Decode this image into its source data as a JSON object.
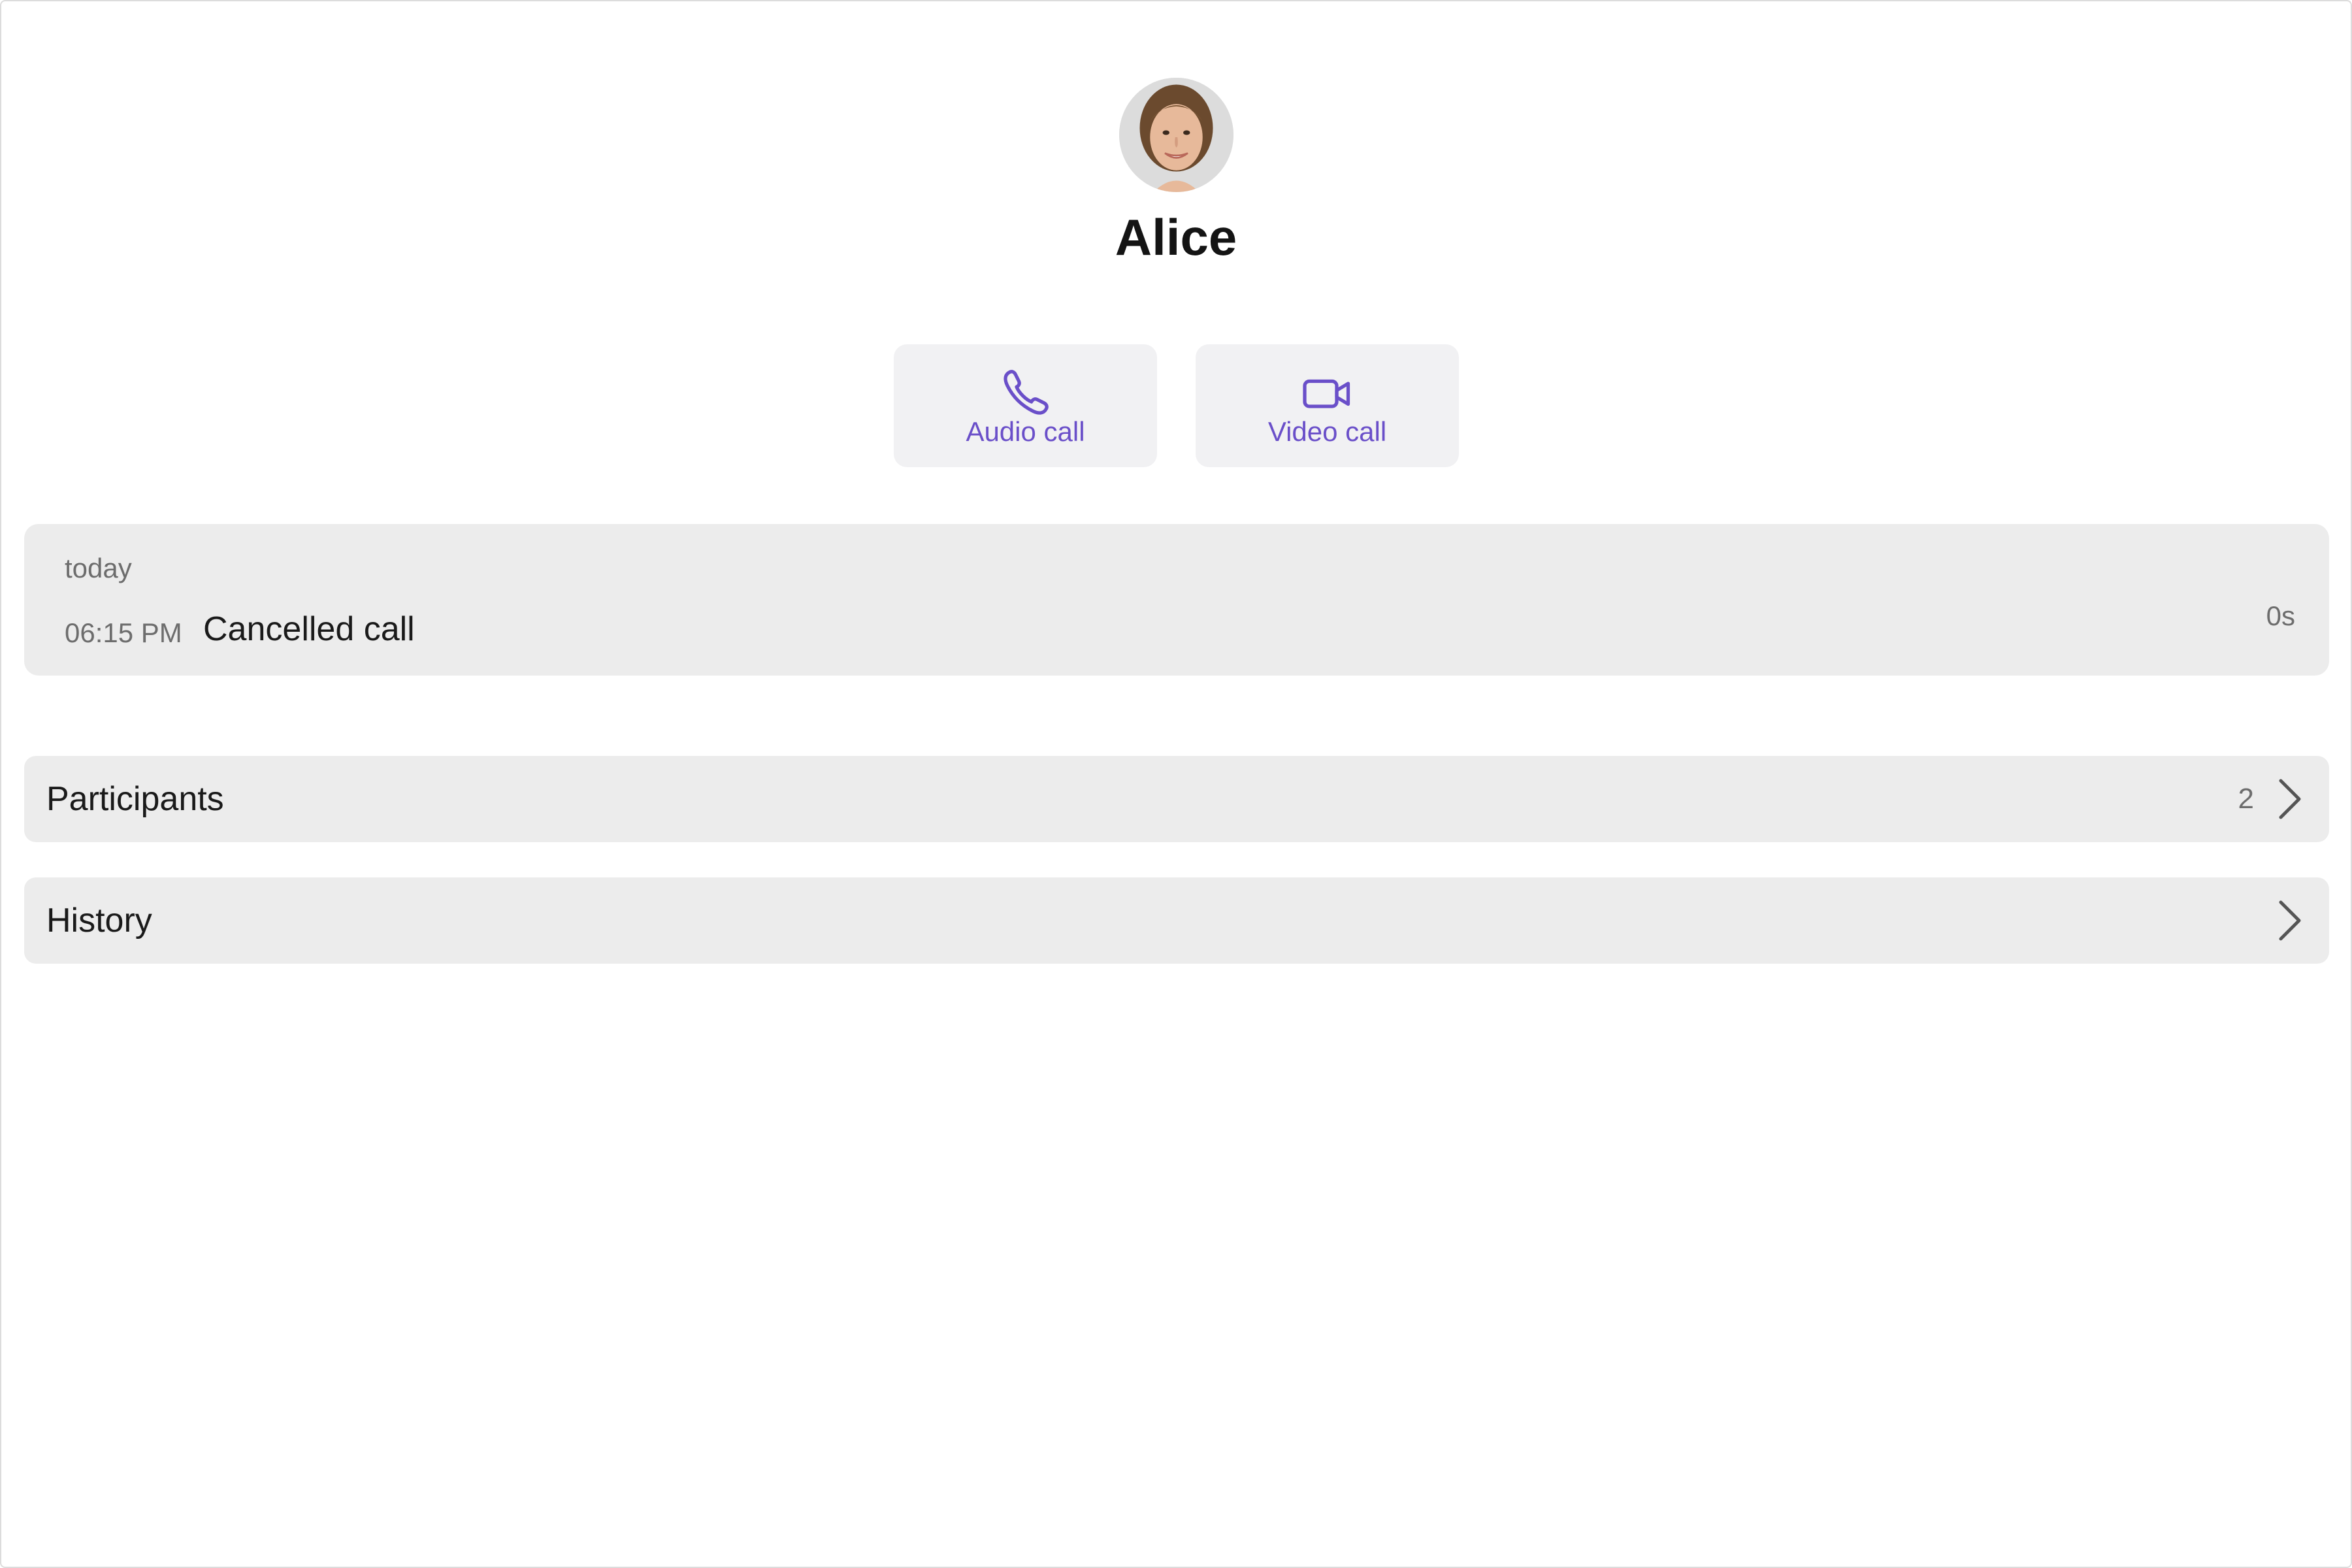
{
  "contact": {
    "name": "Alice",
    "avatar_icon": "avatar-photo"
  },
  "actions": {
    "audio_label": "Audio call",
    "video_label": "Video call",
    "audio_icon": "phone-icon",
    "video_icon": "video-camera-icon",
    "accent_color": "#6a4fc9"
  },
  "call_log": {
    "date": "today",
    "time": "06:15 PM",
    "status": "Cancelled call",
    "duration": "0s"
  },
  "sections": {
    "participants_label": "Participants",
    "participants_count": "2",
    "history_label": "History",
    "chevron_icon": "chevron-right-icon"
  }
}
